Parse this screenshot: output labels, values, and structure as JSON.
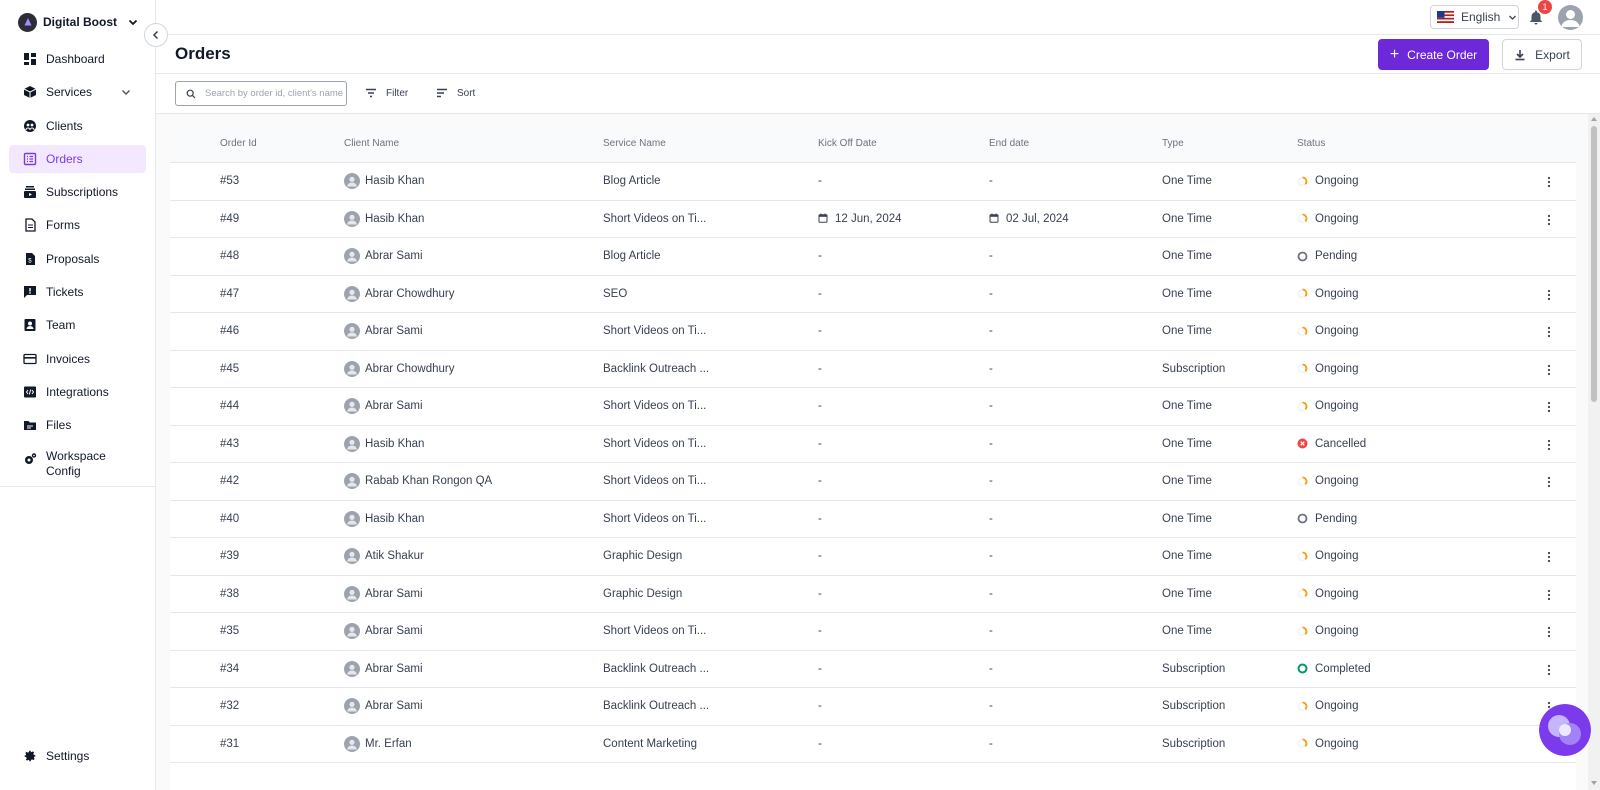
{
  "workspace": {
    "name": "Digital Boost"
  },
  "sidebar": {
    "items": [
      {
        "label": "Dashboard",
        "icon": "dashboard-icon"
      },
      {
        "label": "Services",
        "icon": "cube-icon",
        "has_chevron": true
      },
      {
        "label": "Clients",
        "icon": "clients-icon"
      },
      {
        "label": "Orders",
        "icon": "orders-icon",
        "active": true
      },
      {
        "label": "Subscriptions",
        "icon": "subscriptions-icon"
      },
      {
        "label": "Forms",
        "icon": "forms-icon"
      },
      {
        "label": "Proposals",
        "icon": "proposals-icon"
      },
      {
        "label": "Tickets",
        "icon": "tickets-icon"
      },
      {
        "label": "Team",
        "icon": "team-icon"
      },
      {
        "label": "Invoices",
        "icon": "invoices-icon"
      },
      {
        "label": "Integrations",
        "icon": "integrations-icon"
      },
      {
        "label": "Files",
        "icon": "files-icon"
      },
      {
        "label": "Workspace Config",
        "icon": "workspace-config-icon"
      }
    ],
    "settings_label": "Settings"
  },
  "topbar": {
    "language": "English",
    "notification_count": "1"
  },
  "page": {
    "title": "Orders",
    "create_label": "Create Order",
    "export_label": "Export"
  },
  "toolbar": {
    "search_placeholder": "Search by order id, client's name",
    "filter_label": "Filter",
    "sort_label": "Sort"
  },
  "table": {
    "headers": [
      "Order Id",
      "Client Name",
      "Service Name",
      "Kick Off Date",
      "End date",
      "Type",
      "Status"
    ],
    "rows": [
      {
        "id": "#53",
        "client": "Hasib Khan",
        "service": "Blog Article",
        "kickoff": "-",
        "end": "-",
        "type": "One Time",
        "status": "Ongoing",
        "menu": true
      },
      {
        "id": "#49",
        "client": "Hasib Khan",
        "service": "Short Videos on Ti...",
        "kickoff": "12 Jun, 2024",
        "end": "02 Jul, 2024",
        "type": "One Time",
        "status": "Ongoing",
        "menu": true
      },
      {
        "id": "#48",
        "client": "Abrar Sami",
        "service": "Blog Article",
        "kickoff": "-",
        "end": "-",
        "type": "One Time",
        "status": "Pending",
        "menu": false
      },
      {
        "id": "#47",
        "client": "Abrar Chowdhury",
        "service": "SEO",
        "kickoff": "-",
        "end": "-",
        "type": "One Time",
        "status": "Ongoing",
        "menu": true
      },
      {
        "id": "#46",
        "client": "Abrar Sami",
        "service": "Short Videos on Ti...",
        "kickoff": "-",
        "end": "-",
        "type": "One Time",
        "status": "Ongoing",
        "menu": true
      },
      {
        "id": "#45",
        "client": "Abrar Chowdhury",
        "service": "Backlink Outreach ...",
        "kickoff": "-",
        "end": "-",
        "type": "Subscription",
        "status": "Ongoing",
        "menu": true
      },
      {
        "id": "#44",
        "client": "Abrar Sami",
        "service": "Short Videos on Ti...",
        "kickoff": "-",
        "end": "-",
        "type": "One Time",
        "status": "Ongoing",
        "menu": true
      },
      {
        "id": "#43",
        "client": "Hasib Khan",
        "service": "Short Videos on Ti...",
        "kickoff": "-",
        "end": "-",
        "type": "One Time",
        "status": "Cancelled",
        "menu": true
      },
      {
        "id": "#42",
        "client": "Rabab Khan Rongon QA",
        "service": "Short Videos on Ti...",
        "kickoff": "-",
        "end": "-",
        "type": "One Time",
        "status": "Ongoing",
        "menu": true
      },
      {
        "id": "#40",
        "client": "Hasib Khan",
        "service": "Short Videos on Ti...",
        "kickoff": "-",
        "end": "-",
        "type": "One Time",
        "status": "Pending",
        "menu": false
      },
      {
        "id": "#39",
        "client": "Atik Shakur",
        "service": "Graphic Design",
        "kickoff": "-",
        "end": "-",
        "type": "One Time",
        "status": "Ongoing",
        "menu": true
      },
      {
        "id": "#38",
        "client": "Abrar Sami",
        "service": "Graphic Design",
        "kickoff": "-",
        "end": "-",
        "type": "One Time",
        "status": "Ongoing",
        "menu": true
      },
      {
        "id": "#35",
        "client": "Abrar Sami",
        "service": "Short Videos on Ti...",
        "kickoff": "-",
        "end": "-",
        "type": "One Time",
        "status": "Ongoing",
        "menu": true
      },
      {
        "id": "#34",
        "client": "Abrar Sami",
        "service": "Backlink Outreach ...",
        "kickoff": "-",
        "end": "-",
        "type": "Subscription",
        "status": "Completed",
        "menu": true
      },
      {
        "id": "#32",
        "client": "Abrar Sami",
        "service": "Backlink Outreach ...",
        "kickoff": "-",
        "end": "-",
        "type": "Subscription",
        "status": "Ongoing",
        "menu": true
      },
      {
        "id": "#31",
        "client": "Mr. Erfan",
        "service": "Content Marketing",
        "kickoff": "-",
        "end": "-",
        "type": "Subscription",
        "status": "Ongoing",
        "menu": false
      }
    ]
  },
  "colors": {
    "accent": "#6d28d9",
    "active_nav_bg": "#f3e8ff",
    "ongoing": "#f59e0b",
    "pending": "#6b7280",
    "cancelled": "#ef4444",
    "completed": "#059669"
  }
}
